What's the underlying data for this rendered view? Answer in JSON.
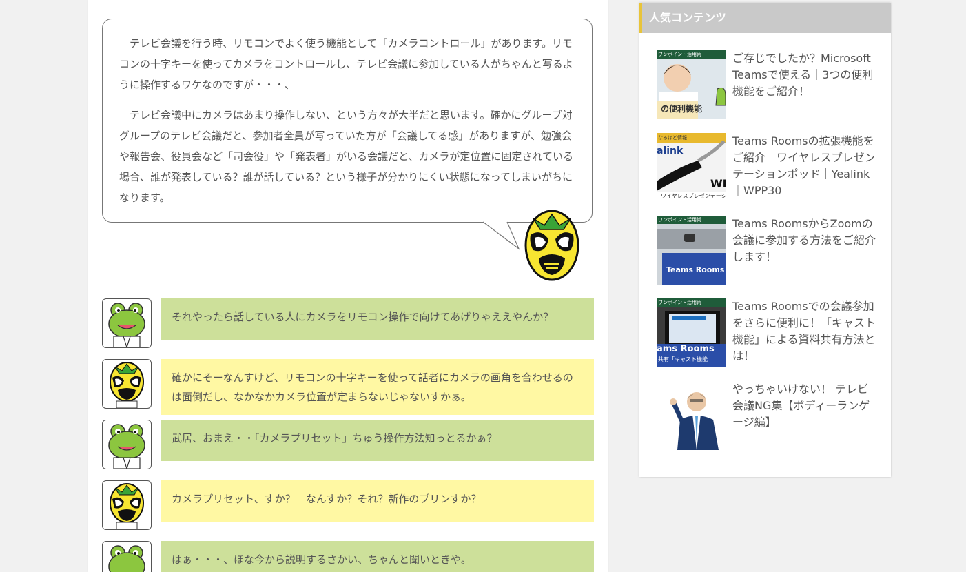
{
  "article": {
    "intro_paragraphs": [
      "テレビ会議を行う時、リモコンでよく使う機能として「カメラコントロール」があります。リモコンの十字キーを使ってカメラをコントロールし、テレビ会議に参加している人がちゃんと写るように操作するワケなのですが・・・、",
      "テレビ会議中にカメラはあまり操作しない、という方々が大半だと思います。確かにグループ対グループのテレビ会議だと、参加者全員が写っていた方が「会議してる感」がありますが、勉強会や報告会、役員会など「司会役」や「発表者」がいる会議だと、カメラが定位置に固定されている場合、誰が発表している？誰が話している？という様子が分かりにくい状態になってしまいがちになります。"
    ],
    "chat": [
      {
        "speaker": "frog",
        "color": "green",
        "text": "それやったら話している人にカメラをリモコン操作で向けてあげりゃええやんか？"
      },
      {
        "speaker": "mask",
        "color": "yellow",
        "text": "確かにそーなんすけど、リモコンの十字キーを使って話者にカメラの画角を合わせるのは面倒だし、なかなかカメラ位置が定まらないじゃないすかぁ。"
      },
      {
        "speaker": "frog",
        "color": "green",
        "text": "武居、おまえ・・「カメラプリセット」ちゅう操作方法知っとるかぁ？"
      },
      {
        "speaker": "mask",
        "color": "yellow",
        "text": "カメラプリセット、すか？　なんすか？それ？新作のプリンすか？"
      },
      {
        "speaker": "frog",
        "color": "green",
        "text": "はぁ・・・、ほな今から説明するさかい、ちゃんと聞いときや。"
      }
    ]
  },
  "sidebar": {
    "heading": "人気コンテンツ",
    "items": [
      {
        "title": "ご存じでしたか？Microsoft Teamsで使える｜3つの便利機能をご紹介！",
        "thumb_banner": "ワンポイント活用術",
        "thumb_caption": "の便利機能"
      },
      {
        "title": "Teams Roomsの拡張機能をご紹介　ワイヤレスプレゼンテーションポッド｜Yealink｜WPP30",
        "thumb_banner": "なるほど情報",
        "thumb_caption": "ワイヤレスプレゼンテーシ",
        "thumb_brand": "alink",
        "thumb_mark": "WI"
      },
      {
        "title": "Teams RoomsからZoomの会議に参加する方法をご紹介します！",
        "thumb_banner": "ワンポイント活用術",
        "thumb_caption": "Teams Rooms"
      },
      {
        "title": "Teams Roomsでの会議参加をさらに便利に！「キャスト機能」による資料共有方法とは！",
        "thumb_banner": "ワンポイント活用術",
        "thumb_caption": "ams Rooms",
        "thumb_sub": "共有「キャスト機能"
      },
      {
        "title": "やっちゃいけない！ テレビ会議NG集【ボディーランゲージ編】"
      }
    ]
  },
  "colors": {
    "bubble_green": "#cde09a",
    "bubble_yellow": "#fff8a3",
    "sidebar_header": "#c9c9c9",
    "sidebar_accent": "#e8c43a"
  },
  "icons": {
    "frog": "frog-avatar-icon",
    "mask": "luchador-mask-icon"
  }
}
